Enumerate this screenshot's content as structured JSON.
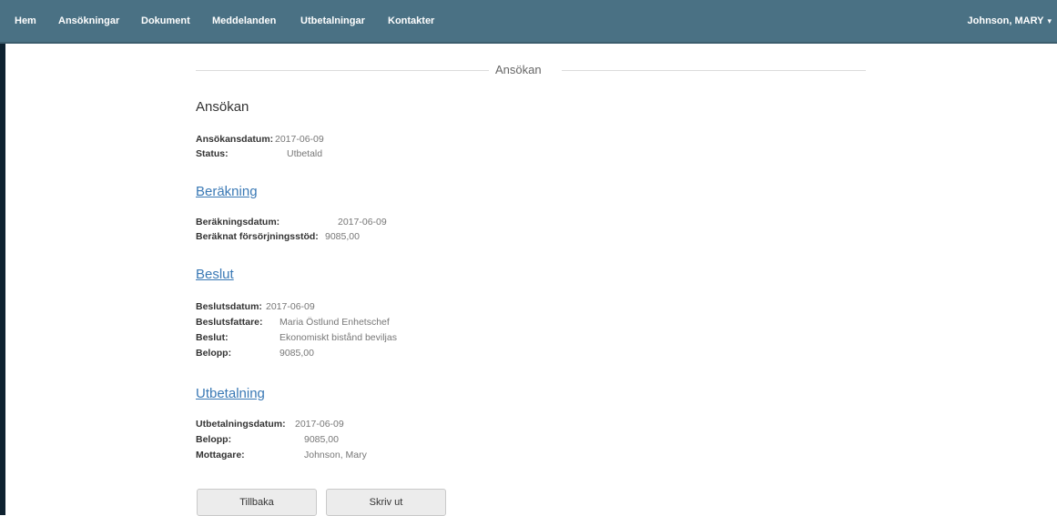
{
  "nav": {
    "items": [
      "Hem",
      "Ansökningar",
      "Dokument",
      "Meddelanden",
      "Utbetalningar",
      "Kontakter"
    ],
    "user": "Johnson, MARY",
    "user_caret": "▾"
  },
  "page": {
    "section_title": "Ansökan",
    "heading": "Ansökan"
  },
  "application": {
    "date_label": "Ansökansdatum:",
    "date_value": "2017-06-09",
    "status_label": "Status:",
    "status_value": "Utbetald"
  },
  "calculation": {
    "heading": "Beräkning",
    "date_label": "Beräkningsdatum:",
    "date_value": "2017-06-09",
    "support_label": "Beräknat försörjningsstöd:",
    "support_value": "9085,00"
  },
  "decision": {
    "heading": "Beslut",
    "date_label": "Beslutsdatum:",
    "date_value": "2017-06-09",
    "maker_label": "Beslutsfattare:",
    "maker_value": "Maria Östlund Enhetschef",
    "decision_label": "Beslut:",
    "decision_value": "Ekonomiskt bistånd beviljas",
    "amount_label": "Belopp:",
    "amount_value": "9085,00"
  },
  "payment": {
    "heading": "Utbetalning",
    "date_label": "Utbetalningsdatum:",
    "date_value": "2017-06-09",
    "amount_label": "Belopp:",
    "amount_value": "9085,00",
    "recipient_label": "Mottagare:",
    "recipient_value": "Johnson, Mary"
  },
  "buttons": {
    "back": "Tillbaka",
    "print": "Skriv ut"
  }
}
